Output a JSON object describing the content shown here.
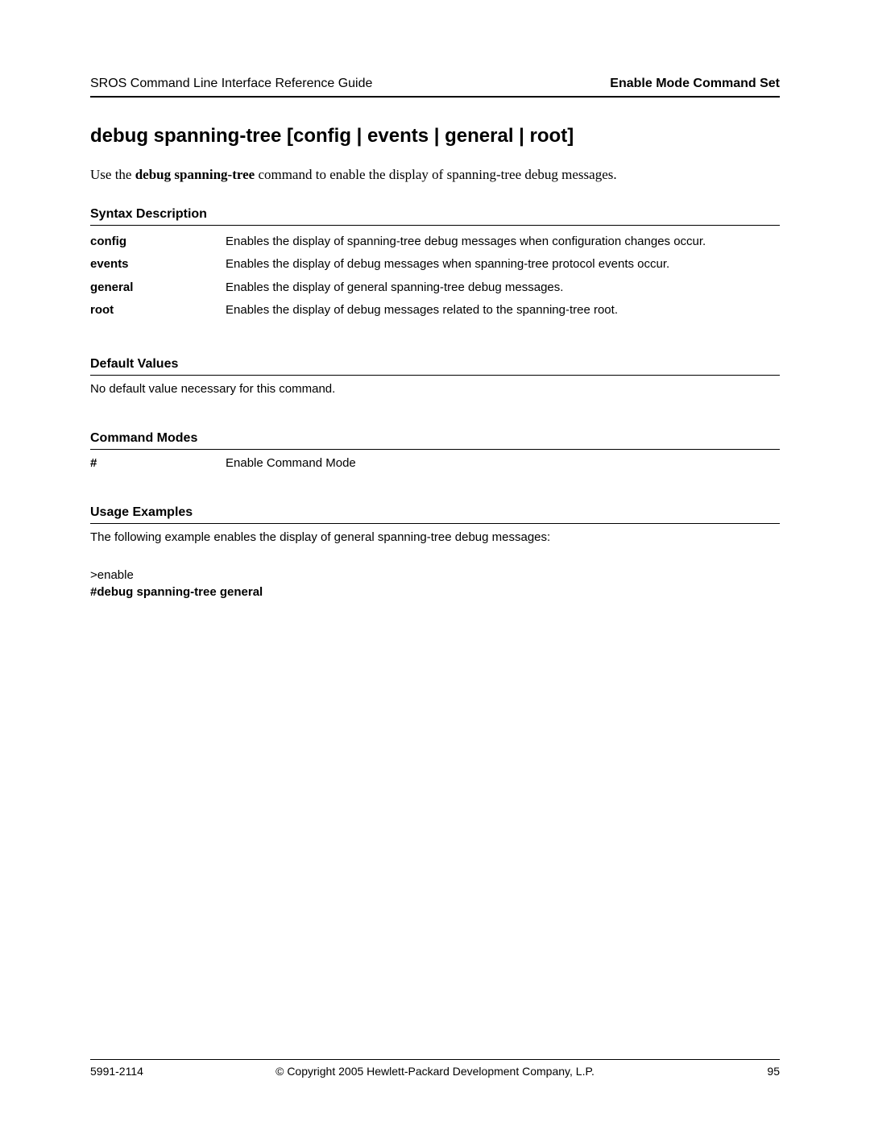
{
  "header": {
    "left": "SROS Command Line Interface Reference Guide",
    "right": "Enable Mode Command Set"
  },
  "title": "debug spanning-tree [config | events | general | root]",
  "intro": {
    "prefix": "Use the ",
    "command": "debug spanning-tree",
    "suffix": " command to enable the display of spanning-tree debug messages."
  },
  "syntax": {
    "heading": "Syntax Description",
    "rows": [
      {
        "key": "config",
        "desc": "Enables the display of spanning-tree debug messages when configuration changes occur."
      },
      {
        "key": "events",
        "desc": "Enables the display of debug messages when spanning-tree protocol events occur."
      },
      {
        "key": "general",
        "desc": "Enables the display of general spanning-tree debug messages."
      },
      {
        "key": "root",
        "desc": "Enables the display of debug messages related to the spanning-tree root."
      }
    ]
  },
  "defaults": {
    "heading": "Default Values",
    "text": "No default value necessary for this command."
  },
  "modes": {
    "heading": "Command Modes",
    "symbol": "#",
    "text": "Enable Command Mode"
  },
  "usage": {
    "heading": "Usage Examples",
    "intro": "The following example enables the display of general spanning-tree debug messages:",
    "line1": ">enable",
    "line2": "#debug spanning-tree general"
  },
  "footer": {
    "left": "5991-2114",
    "center": "© Copyright 2005 Hewlett-Packard Development Company, L.P.",
    "right": "95"
  }
}
